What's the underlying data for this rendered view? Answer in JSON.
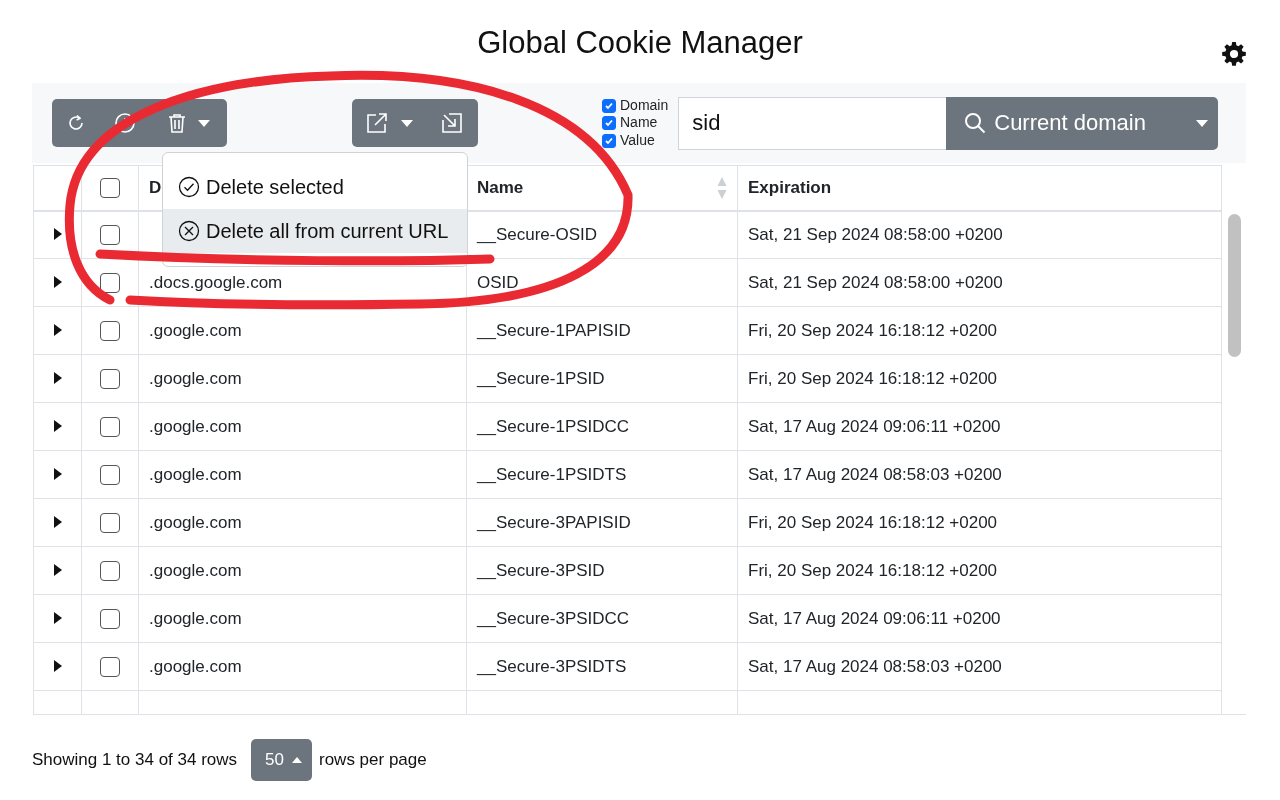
{
  "title": "Global Cookie Manager",
  "filters": [
    {
      "label": "Domain",
      "checked": true
    },
    {
      "label": "Name",
      "checked": true
    },
    {
      "label": "Value",
      "checked": true
    }
  ],
  "search": {
    "value": "sid"
  },
  "search_button": {
    "label": "Current domain"
  },
  "menu": {
    "items": [
      {
        "kind": "check",
        "label": "Delete selected",
        "selected": false
      },
      {
        "kind": "cross",
        "label": "Delete all from current URL",
        "selected": true
      }
    ]
  },
  "table": {
    "select_all_checked": false,
    "columns": [
      {
        "label": "D",
        "sortable": false
      },
      {
        "label": "Name",
        "sortable": true
      },
      {
        "label": "Expiration",
        "sortable": false
      }
    ],
    "rows": [
      {
        "expanded": false,
        "checked": false,
        "name": "__Secure-OSID",
        "expiration": "Sat, 21 Sep 2024 08:58:00 +0200"
      },
      {
        "expanded": false,
        "checked": false,
        "domain": ".docs.google.com",
        "name": "OSID",
        "expiration": "Sat, 21 Sep 2024 08:58:00 +0200"
      },
      {
        "expanded": false,
        "checked": false,
        "domain": ".google.com",
        "name": "__Secure-1PAPISID",
        "expiration": "Fri, 20 Sep 2024 16:18:12 +0200"
      },
      {
        "expanded": false,
        "checked": false,
        "domain": ".google.com",
        "name": "__Secure-1PSID",
        "expiration": "Fri, 20 Sep 2024 16:18:12 +0200"
      },
      {
        "expanded": false,
        "checked": false,
        "domain": ".google.com",
        "name": "__Secure-1PSIDCC",
        "expiration": "Sat, 17 Aug 2024 09:06:11 +0200"
      },
      {
        "expanded": false,
        "checked": false,
        "domain": ".google.com",
        "name": "__Secure-1PSIDTS",
        "expiration": "Sat, 17 Aug 2024 08:58:03 +0200"
      },
      {
        "expanded": false,
        "checked": false,
        "domain": ".google.com",
        "name": "__Secure-3PAPISID",
        "expiration": "Fri, 20 Sep 2024 16:18:12 +0200"
      },
      {
        "expanded": false,
        "checked": false,
        "domain": ".google.com",
        "name": "__Secure-3PSID",
        "expiration": "Fri, 20 Sep 2024 16:18:12 +0200"
      },
      {
        "expanded": false,
        "checked": false,
        "domain": ".google.com",
        "name": "__Secure-3PSIDCC",
        "expiration": "Sat, 17 Aug 2024 09:06:11 +0200"
      },
      {
        "expanded": false,
        "checked": false,
        "domain": ".google.com",
        "name": "__Secure-3PSIDTS",
        "expiration": "Sat, 17 Aug 2024 08:58:03 +0200"
      }
    ]
  },
  "footer": {
    "summary": "Showing 1 to 34 of 34 rows",
    "page_size": "50",
    "suffix": "rows per page"
  }
}
